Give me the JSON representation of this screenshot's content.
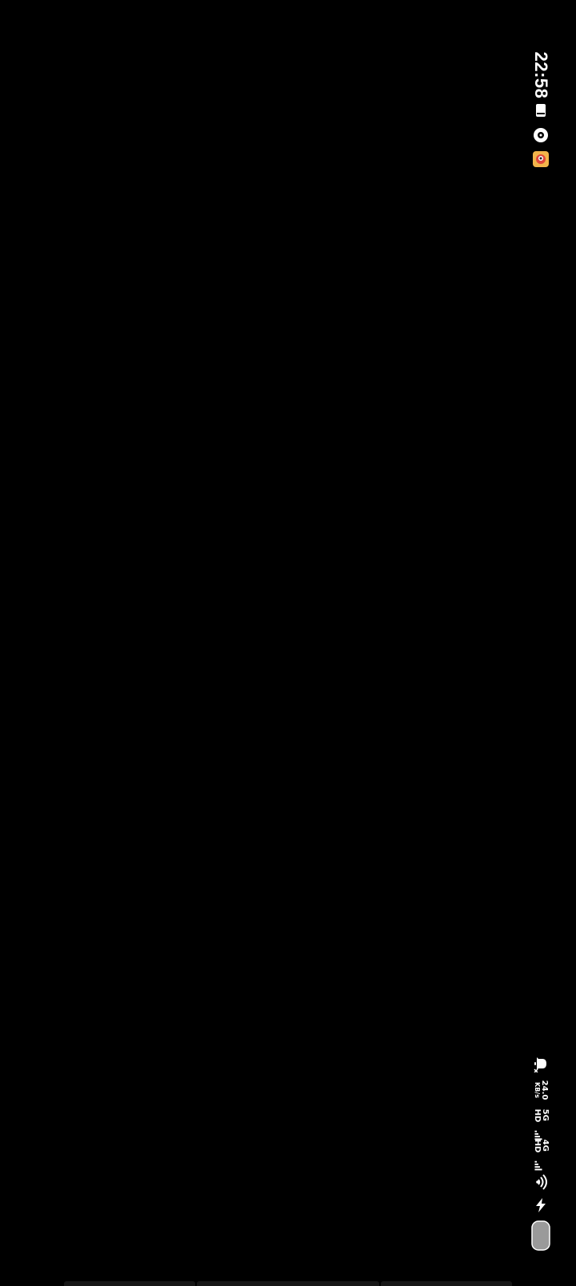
{
  "status_bar": {
    "time": "22:58",
    "network_speed": {
      "value": "24.0",
      "unit": "KB/s"
    },
    "signal_1_label": "5G HD",
    "signal_2_label": "4G HD",
    "icons": [
      "screenshot-icon",
      "music-icon",
      "app-notification-icon",
      "mute-icon",
      "wifi-icon",
      "charging-icon",
      "battery-icon"
    ]
  },
  "colors": {
    "background": "#000000",
    "status_text": "#ffffff",
    "app_icon": "#f2b44a"
  }
}
